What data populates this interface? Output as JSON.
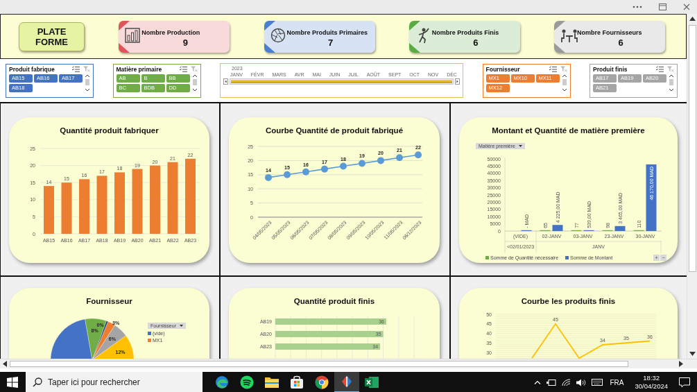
{
  "platform_button": "PLATE FORME",
  "kpis": [
    {
      "label": "Nombre Production",
      "value": "9",
      "color": "#e0555b",
      "kind": "chart"
    },
    {
      "label": "Nombre Produits Primaires",
      "value": "7",
      "color": "#4a7fd0",
      "kind": "aperture"
    },
    {
      "label": "Nombre Produits Finis",
      "value": "6",
      "color": "#5aab45",
      "kind": "figure"
    },
    {
      "label": "Nombre Fournisseurs",
      "value": "6",
      "color": "#9a9a9a",
      "kind": "meeting"
    }
  ],
  "filters": [
    {
      "kind": "slicer",
      "title": "Produit fabrique",
      "color": "#4472c4",
      "items": [
        {
          "label": "AB15",
          "selected": true
        },
        {
          "label": "AB16",
          "selected": true
        },
        {
          "label": "AB17",
          "selected": true
        },
        {
          "label": "AB18",
          "selected": true
        }
      ]
    },
    {
      "kind": "slicer",
      "title": "Matière primaire",
      "color": "#70ad47",
      "items": [
        {
          "label": "AB",
          "selected": true
        },
        {
          "label": "B",
          "selected": true
        },
        {
          "label": "BB",
          "selected": true
        },
        {
          "label": "BC",
          "selected": true
        },
        {
          "label": "BDB",
          "selected": true
        },
        {
          "label": "DD",
          "selected": true
        }
      ]
    },
    {
      "kind": "timeline",
      "year": "2023",
      "months": [
        "JANV",
        "FÉVR",
        "MARS",
        "AVR",
        "MAI",
        "JUIN",
        "JUIL",
        "AOÛT",
        "SEPT",
        "OCT",
        "NOV",
        "DÉC"
      ],
      "level": 1
    },
    {
      "kind": "slicer",
      "title": "Fournisseur",
      "color": "#ed7d31",
      "items": [
        {
          "label": "MX1",
          "selected": true
        },
        {
          "label": "MX10",
          "selected": true
        },
        {
          "label": "MX11",
          "selected": true
        },
        {
          "label": "MX12",
          "selected": true
        }
      ]
    },
    {
      "kind": "slicer",
      "title": "Produit finis",
      "color": "#a5a5a5",
      "items": [
        {
          "label": "AB17",
          "selected": true
        },
        {
          "label": "AB19",
          "selected": true
        },
        {
          "label": "AB20",
          "selected": true
        },
        {
          "label": "AB21",
          "selected": true
        }
      ]
    }
  ],
  "panels": [
    {
      "kind": "column",
      "title": "Quantité produit fabriquer",
      "chart_data": {
        "type": "bar",
        "categories": [
          "AB15",
          "AB16",
          "AB17",
          "AB18",
          "AB19",
          "AB20",
          "AB21",
          "AB22",
          "AB23"
        ],
        "values": [
          14,
          15,
          16,
          17,
          18,
          19,
          20,
          21,
          22
        ],
        "yticks": [
          0,
          5,
          10,
          15,
          20,
          25
        ],
        "ylim": [
          0,
          25
        ],
        "grid": true,
        "data_labels": true
      }
    },
    {
      "kind": "marker_line",
      "title": "Courbe Quantité de produit fabriqué",
      "chart_data": {
        "type": "line",
        "categories": [
          "04/05/2023",
          "05/05/2023",
          "06/05/2023",
          "07/05/2023",
          "08/05/2023",
          "09/05/2023",
          "10/05/2023",
          "11/05/2023",
          "06/12/2023"
        ],
        "values": [
          14,
          15,
          16,
          17,
          18,
          19,
          20,
          21,
          22
        ],
        "yticks": [
          0,
          5,
          10,
          15,
          20,
          25
        ],
        "ylim": [
          0,
          25
        ],
        "grid": true,
        "marker": true,
        "data_labels": true
      }
    },
    {
      "kind": "clustered",
      "title": "Montant et Quantité de matière première",
      "dropdown": "Matière première",
      "category_groups": [
        {
          "label": "<02/01/2023",
          "children": [
            "(VIDE)"
          ]
        },
        {
          "label": "JANV",
          "children": [
            "02-JANV",
            "03-JANV",
            "23-JANV",
            "30-JANV"
          ]
        }
      ],
      "chart_data": {
        "type": "bar",
        "ylim": [
          0,
          50000
        ],
        "yticks": [
          0,
          5000,
          10000,
          15000,
          20000,
          25000,
          30000,
          35000,
          40000,
          45000,
          50000
        ],
        "series": [
          {
            "name": "Somme de Quantité nécessaire",
            "color": "#70ad47",
            "values": [
              null,
              65,
              77,
              98,
              110
            ],
            "value_labels": [
              null,
              "65",
              "77",
              "98",
              "110"
            ]
          },
          {
            "name": "Somme de Montant",
            "color": "#4472c4",
            "values": [
              0,
              4225,
              539,
              3465,
              46170
            ],
            "value_labels": [
              "- MAD",
              "4 225,00 MAD",
              "539,00 MAD",
              "3 465,00 MAD",
              "46 170,00 MAD"
            ]
          }
        ]
      },
      "zoom_buttons": [
        "+",
        "−"
      ]
    },
    {
      "kind": "pie",
      "title": "Fournisseur",
      "dropdown": "Fournisseur",
      "legend": [
        {
          "label": "(vide)",
          "color": "#4472c4"
        },
        {
          "label": "MX1",
          "color": "#ed7d31"
        }
      ],
      "slices": [
        {
          "color": "#4472c4"
        },
        {
          "label": "8%",
          "color": "#70ad47"
        },
        {
          "label": "0%",
          "color": "#264478"
        },
        {
          "label": "3%",
          "color": "#ed7d31"
        },
        {
          "label": "6%",
          "color": "#a5a5a5"
        },
        {
          "label": "12%",
          "color": "#ffc000"
        }
      ]
    },
    {
      "kind": "hbar",
      "title": "Quantité produit finis",
      "chart_data": {
        "type": "bar",
        "orientation": "horizontal",
        "categories": [
          "AB19",
          "AB20",
          "AB23"
        ],
        "values": [
          36,
          35,
          34
        ],
        "xlim": [
          0,
          45
        ],
        "grid": true,
        "data_labels": true
      }
    },
    {
      "kind": "plain_line",
      "title": "Courbe les produits finis",
      "y_labels": [
        "50",
        "45",
        "40",
        "35",
        "30"
      ],
      "point_labels": [
        "45",
        "34",
        "35",
        "36"
      ]
    }
  ],
  "taskbar": {
    "search": {
      "placeholder": "Taper ici pour rechercher"
    },
    "apps": [
      {
        "kind": "edge",
        "selected": false
      },
      {
        "kind": "spotify",
        "selected": false
      },
      {
        "kind": "folder",
        "selected": false
      },
      {
        "kind": "store",
        "selected": false
      },
      {
        "kind": "chrome",
        "selected": false
      },
      {
        "kind": "tool",
        "selected": true
      },
      {
        "kind": "excel",
        "selected": false
      }
    ],
    "language": "FRA",
    "time": "18:32",
    "date": "30/04/2024"
  }
}
